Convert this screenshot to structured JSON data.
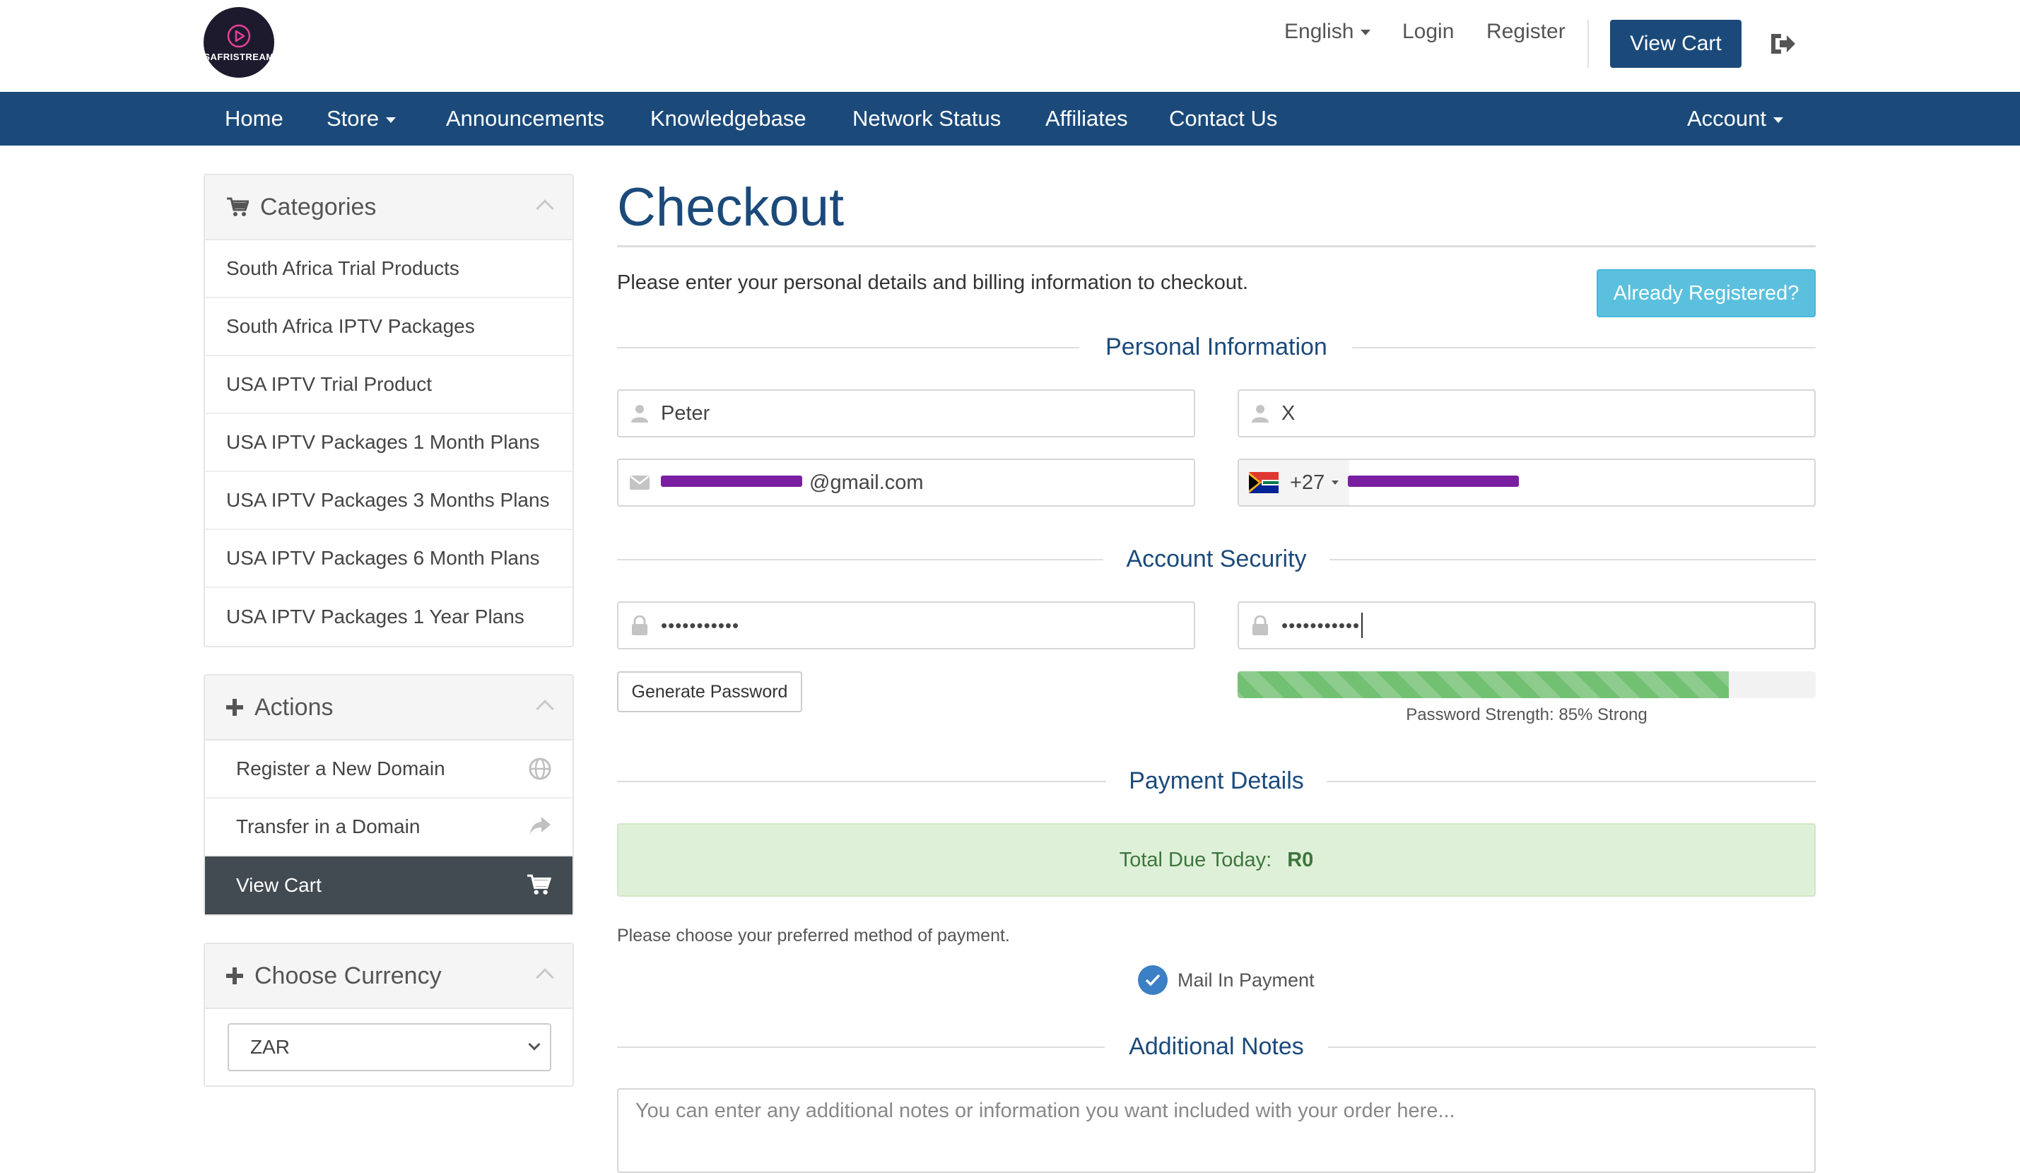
{
  "brand": {
    "logo_text": "SAFRISTREAM"
  },
  "header": {
    "language": "English",
    "login": "Login",
    "register": "Register",
    "view_cart": "View Cart"
  },
  "nav": {
    "items": [
      "Home",
      "Store",
      "Announcements",
      "Knowledgebase",
      "Network Status",
      "Affiliates",
      "Contact Us"
    ],
    "account": "Account"
  },
  "sidebar": {
    "categories": {
      "title": "Categories",
      "items": [
        "South Africa Trial Products",
        "South Africa IPTV Packages",
        "USA IPTV Trial Product",
        "USA IPTV Packages 1 Month Plans",
        "USA IPTV Packages 3 Months Plans",
        "USA IPTV Packages 6 Month Plans",
        "USA IPTV Packages 1 Year Plans"
      ]
    },
    "actions": {
      "title": "Actions",
      "items": [
        "Register a New Domain",
        "Transfer in a Domain",
        "View Cart"
      ]
    },
    "currency": {
      "title": "Choose Currency",
      "selected": "ZAR"
    }
  },
  "checkout": {
    "title": "Checkout",
    "intro": "Please enter your personal details and billing information to checkout.",
    "already_registered": "Already Registered?",
    "personal_section": "Personal Information",
    "first_name": "Peter",
    "last_name": "X",
    "email_visible": "@gmail.com",
    "phone_code": "+27",
    "security_section": "Account Security",
    "password": "•••••••••••",
    "password_confirm": "•••••••••••",
    "generate_password": "Generate Password",
    "password_strength_percent": 85,
    "password_strength_text": "Password Strength: 85% Strong",
    "payment_section": "Payment Details",
    "total_label": "Total Due Today:",
    "total_value": "R0",
    "payment_prompt": "Please choose your preferred method of payment.",
    "payment_method": "Mail In Payment",
    "notes_section": "Additional Notes",
    "notes_placeholder": "You can enter any additional notes or information you want included with your order here..."
  },
  "colors": {
    "primary": "#1b4a7a",
    "info_button": "#5bc0de",
    "success_bg": "#dff0d8",
    "success_text": "#3c763d",
    "active_item": "#424b51",
    "strength_bar": "#5cb85c"
  },
  "icons": [
    "play-logo-icon",
    "logout-icon",
    "cart-icon",
    "plus-icon",
    "chevron-up-icon",
    "globe-icon",
    "share-arrow-icon",
    "user-icon",
    "envelope-icon",
    "south-africa-flag-icon",
    "lock-icon",
    "check-circle-icon",
    "chevron-down-icon"
  ]
}
